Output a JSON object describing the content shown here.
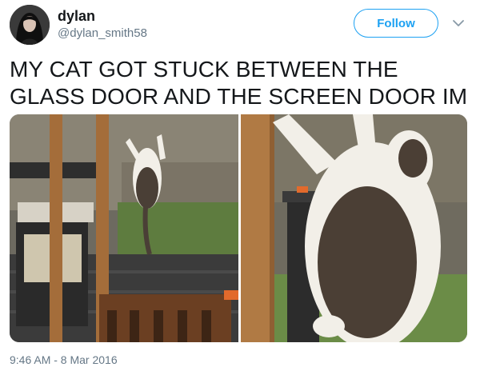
{
  "author": {
    "display_name": "dylan",
    "handle": "@dylan_smith58",
    "avatar_icon": "profile-photo"
  },
  "actions": {
    "follow_label": "Follow",
    "more_icon": "chevron-down-icon"
  },
  "tweet": {
    "text": "MY CAT GOT STUCK BETWEEN THE GLASS DOOR AND THE SCREEN DOOR IM CRYING",
    "timestamp": "9:46 AM - 8 Mar 2016"
  },
  "media": {
    "count": 2,
    "items": [
      {
        "description_icon": "photo-cat-on-screen-door-wide"
      },
      {
        "description_icon": "photo-cat-on-screen-door-closeup"
      }
    ]
  },
  "colors": {
    "accent": "#1da1f2",
    "text": "#14171a",
    "secondary_text": "#657786"
  }
}
